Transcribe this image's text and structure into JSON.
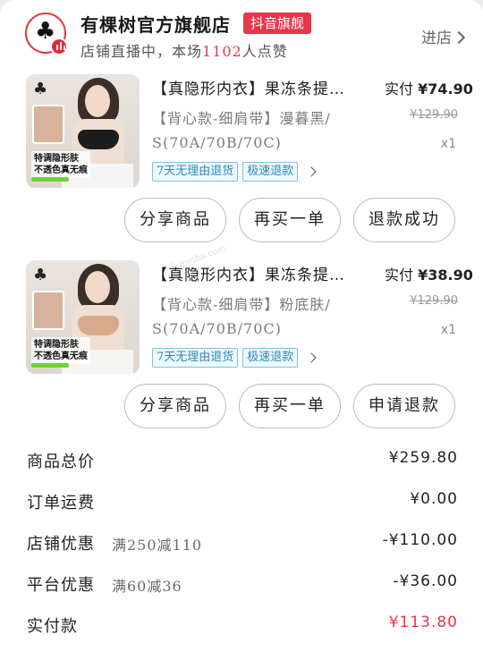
{
  "shop": {
    "name": "有棵树官方旗舰店",
    "badge": "抖音旗舰",
    "live_prefix": "店铺直播中，本场",
    "live_count": "1102",
    "live_suffix": "人点赞",
    "enter_label": "进店"
  },
  "products": [
    {
      "title": "【真隐形内衣】果冻条提…",
      "pay_label": "实付",
      "pay_value": "¥74.90",
      "spec_line1": "【背心款-细肩带】漫暮黑/",
      "spec_line2": "S(70A/70B/70C)",
      "original_price": "¥129.90",
      "quantity": "x1",
      "tags": [
        "7天无理由退货",
        "极速退款"
      ],
      "image_caption": "特调隐形肤\n不透色真无痕",
      "bra_color": "#1d1d1d",
      "buttons": [
        "分享商品",
        "再买一单",
        "退款成功"
      ]
    },
    {
      "title": "【真隐形内衣】果冻条提…",
      "pay_label": "实付",
      "pay_value": "¥38.90",
      "spec_line1": "【背心款-细肩带】粉底肤/",
      "spec_line2": "S(70A/70B/70C)",
      "original_price": "¥129.90",
      "quantity": "x1",
      "tags": [
        "7天无理由退货",
        "极速退款"
      ],
      "image_caption": "特调隐形肤\n不透色真无痕",
      "bra_color": "#d9a98c",
      "buttons": [
        "分享商品",
        "再买一单",
        "申请退款"
      ]
    }
  ],
  "summary": {
    "total_label": "商品总价",
    "total_value": "¥259.80",
    "shipping_label": "订单运费",
    "shipping_value": "¥0.00",
    "shop_discount_label": "店铺优惠",
    "shop_discount_rule": "满250减110",
    "shop_discount_value": "-¥110.00",
    "platform_discount_label": "平台优惠",
    "platform_discount_rule": "满60减36",
    "platform_discount_value": "-¥36.00",
    "paid_label": "实付款",
    "paid_value": "¥113.80"
  },
  "watermark": "k.meiha.com",
  "colors": {
    "accent": "#e8364a",
    "tag_border": "#7cc2e2",
    "tag_text": "#2d8ab8"
  }
}
